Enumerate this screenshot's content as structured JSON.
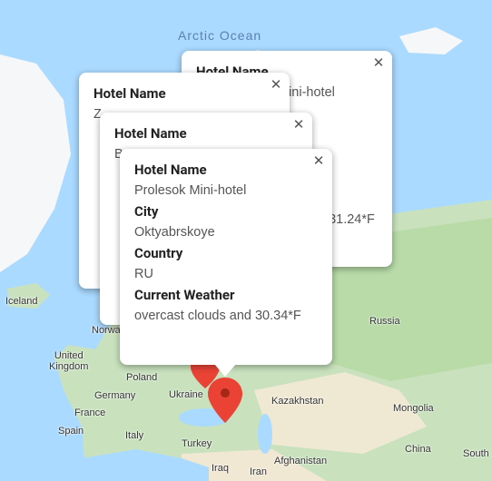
{
  "map": {
    "ocean_label": "Arctic Ocean",
    "labels": [
      {
        "id": "iceland",
        "text": "Iceland"
      },
      {
        "id": "norway",
        "text": "Norway"
      },
      {
        "id": "uk",
        "text": "United\nKingdom"
      },
      {
        "id": "poland",
        "text": "Poland"
      },
      {
        "id": "germany",
        "text": "Germany"
      },
      {
        "id": "ukraine",
        "text": "Ukraine"
      },
      {
        "id": "france",
        "text": "France"
      },
      {
        "id": "spain",
        "text": "Spain"
      },
      {
        "id": "italy",
        "text": "Italy"
      },
      {
        "id": "turkey",
        "text": "Turkey"
      },
      {
        "id": "iraq",
        "text": "Iraq"
      },
      {
        "id": "iran",
        "text": "Iran"
      },
      {
        "id": "afghanistan",
        "text": "Afghanistan"
      },
      {
        "id": "kazakhstan",
        "text": "Kazakhstan"
      },
      {
        "id": "mongolia",
        "text": "Mongolia"
      },
      {
        "id": "russia",
        "text": "Russia"
      },
      {
        "id": "china",
        "text": "China"
      },
      {
        "id": "south",
        "text": "South"
      }
    ],
    "colors": {
      "water": "#aadaff",
      "land": "#c9e2bd",
      "forest": "#a9d39e",
      "desert": "#f1e8d4",
      "ice": "#f5f7f8",
      "marker": "#ea4335"
    }
  },
  "info_windows": [
    {
      "id": "back",
      "close_label": "✕",
      "hotel_label": "Hotel Name",
      "hotel_value": "...ini-hotel",
      "weather_value": "...31.24*F"
    },
    {
      "id": "left",
      "close_label": "✕",
      "hotel_label": "Hotel Name",
      "hotel_value": "Z..."
    },
    {
      "id": "middle",
      "close_label": "✕",
      "hotel_label": "Hotel Name",
      "hotel_value": "B..."
    },
    {
      "id": "front",
      "close_label": "✕",
      "hotel_label": "Hotel Name",
      "hotel_value": "Prolesok Mini-hotel",
      "city_label": "City",
      "city_value": "Oktyabrskoye",
      "country_label": "Country",
      "country_value": "RU",
      "weather_label": "Current Weather",
      "weather_value": "overcast clouds and 30.34*F"
    }
  ]
}
